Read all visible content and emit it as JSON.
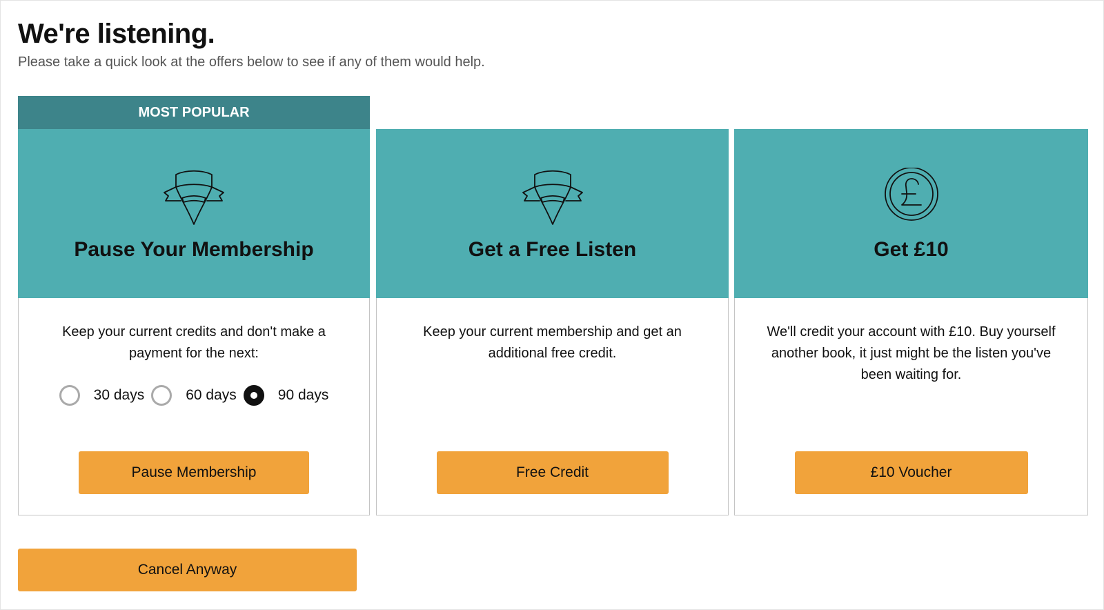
{
  "header": {
    "title": "We're listening.",
    "subtitle": "Please take a quick look at the offers below to see if any of them would help."
  },
  "badge": {
    "label": "MOST POPULAR"
  },
  "offers": [
    {
      "icon": "ribbon-badge-icon",
      "title": "Pause Your Membership",
      "description": "Keep your current credits and don't make a payment for the next:",
      "options": [
        "30 days",
        "60 days",
        "90 days"
      ],
      "selected_option": "90 days",
      "button_label": "Pause Membership"
    },
    {
      "icon": "ribbon-badge-icon",
      "title": "Get a Free Listen",
      "description": "Keep your current membership and get an additional free credit.",
      "button_label": "Free Credit"
    },
    {
      "icon": "pound-coin-icon",
      "title": "Get £10",
      "description": "We'll credit your account with £10. Buy yourself another book, it just might be the listen you've been waiting for.",
      "button_label": "£10 Voucher"
    }
  ],
  "cancel_label": "Cancel Anyway",
  "colors": {
    "teal": "#4faeb1",
    "banner_teal": "#3d848a",
    "button_orange": "#f1a33b"
  }
}
